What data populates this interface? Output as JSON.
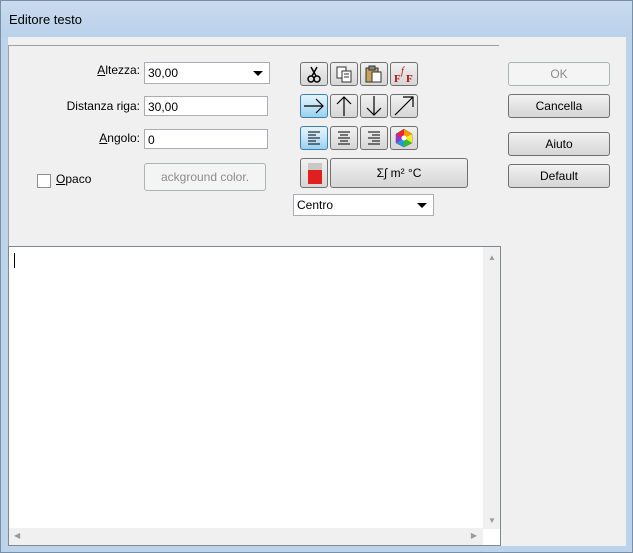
{
  "window": {
    "title": "Editore testo"
  },
  "fields": {
    "altezza_label": "Altezza:",
    "altezza_value": "30,00",
    "distanza_label": "Distanza riga:",
    "distanza_value": "30,00",
    "angolo_label": "Angolo:",
    "angolo_value": "0",
    "opaco_label": "Opaco",
    "background_button": "ackground color.",
    "symbols_button": "Σ∫ m² °C",
    "align_select": "Centro"
  },
  "buttons": {
    "ok": "OK",
    "cancel": "Cancella",
    "help": "Aiuto",
    "default": "Default"
  },
  "editor": {
    "text": ""
  },
  "colors": {
    "text_color_swatch": "#e01f1f"
  }
}
